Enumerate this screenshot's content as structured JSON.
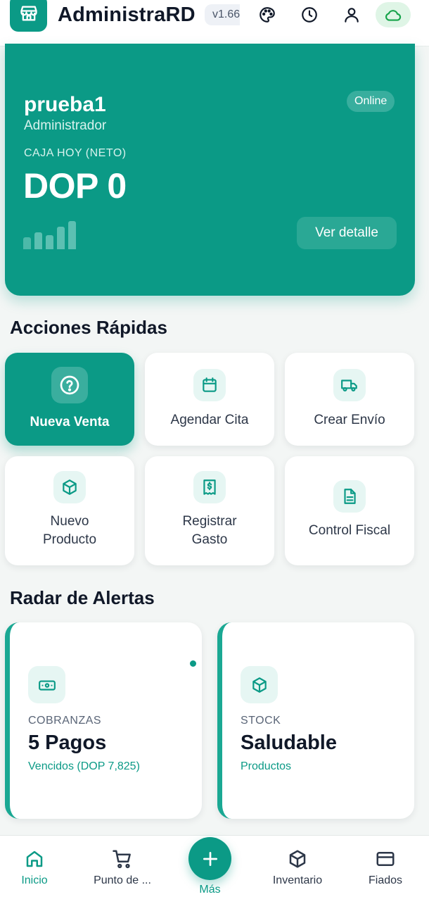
{
  "header": {
    "title": "AdministraRD",
    "version": "v1.66",
    "icons": [
      "store-icon",
      "palette-icon",
      "clock-icon",
      "user-icon",
      "cloud-icon"
    ]
  },
  "hero": {
    "user": "prueba1",
    "role": "Administrador",
    "status": "Online",
    "caja_label": "CAJA HOY (NETO)",
    "caja_value": "DOP 0",
    "detail_button": "Ver detalle"
  },
  "quick_actions": {
    "title": "Acciones Rápidas",
    "items": [
      {
        "label": "Nueva Venta",
        "icon": "help-circle-icon"
      },
      {
        "label": "Agendar Cita",
        "icon": "calendar-icon"
      },
      {
        "label": "Crear Envío",
        "icon": "truck-icon"
      },
      {
        "label": "Nuevo Producto",
        "icon": "box-icon"
      },
      {
        "label": "Registrar Gasto",
        "icon": "receipt-icon"
      },
      {
        "label": "Control Fiscal",
        "icon": "document-icon"
      }
    ]
  },
  "alerts": {
    "title": "Radar de Alertas",
    "items": [
      {
        "category": "COBRANZAS",
        "value": "5 Pagos",
        "sub": "Vencidos (DOP 7,825)",
        "icon": "money-icon"
      },
      {
        "category": "STOCK",
        "value": "Saludable",
        "sub": "Productos",
        "icon": "box-icon"
      }
    ]
  },
  "bottom_nav": {
    "items": [
      {
        "label": "Inicio",
        "icon": "home-icon"
      },
      {
        "label": "Punto de ...",
        "icon": "cart-icon"
      },
      {
        "label": "Más",
        "icon": "plus-icon"
      },
      {
        "label": "Inventario",
        "icon": "box-icon"
      },
      {
        "label": "Fiados",
        "icon": "credit-card-icon"
      }
    ]
  },
  "colors": {
    "accent": "#0b9a86",
    "accent_light": "#e6f6f3",
    "cloud_pill": "#dff5e6"
  }
}
